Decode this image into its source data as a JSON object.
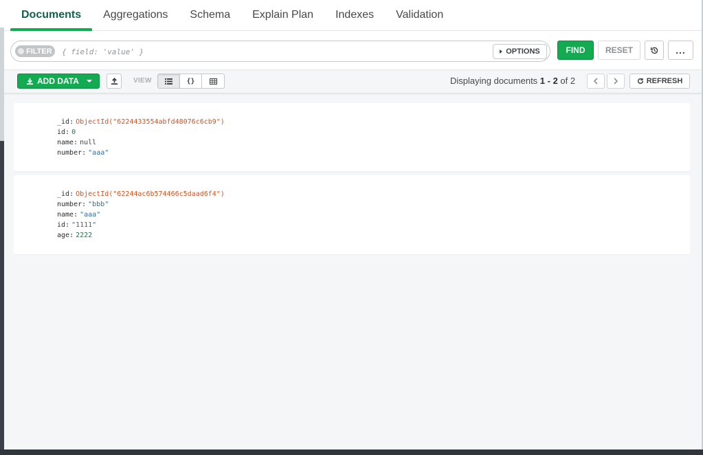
{
  "tabs": [
    {
      "label": "Documents",
      "active": true
    },
    {
      "label": "Aggregations",
      "active": false
    },
    {
      "label": "Schema",
      "active": false
    },
    {
      "label": "Explain Plan",
      "active": false
    },
    {
      "label": "Indexes",
      "active": false
    },
    {
      "label": "Validation",
      "active": false
    }
  ],
  "query": {
    "filter_label": "FILTER",
    "filter_placeholder": "{ field: 'value' }",
    "options_label": "OPTIONS",
    "find_label": "FIND",
    "reset_label": "RESET",
    "history_icon": "history-icon",
    "more_label": "..."
  },
  "toolbar": {
    "add_data_label": "ADD DATA",
    "view_label": "VIEW",
    "view_modes": [
      "list-icon",
      "json-icon",
      "table-icon"
    ],
    "view_json_glyph": "{}",
    "paging_prefix": "Displaying documents ",
    "paging_range": "1 - 2",
    "paging_of": " of ",
    "paging_total": "2",
    "refresh_label": "REFRESH"
  },
  "documents": [
    {
      "fields": [
        {
          "key": "_id",
          "value": "ObjectId(\"6224433554abfd48076c6cb9\")",
          "type": "oid"
        },
        {
          "key": "id",
          "value": "0",
          "type": "num"
        },
        {
          "key": "name",
          "value": "null",
          "type": "null"
        },
        {
          "key": "number",
          "value": "\"aaa\"",
          "type": "str"
        }
      ]
    },
    {
      "fields": [
        {
          "key": "_id",
          "value": "ObjectId(\"62244ac6b574466c5daad6f4\")",
          "type": "oid"
        },
        {
          "key": "number",
          "value": "\"bbb\"",
          "type": "str"
        },
        {
          "key": "name",
          "value": "\"aaa\"",
          "type": "str"
        },
        {
          "key": "id",
          "value": "\"1111\"",
          "type": "str"
        },
        {
          "key": "age",
          "value": "2222",
          "type": "num"
        }
      ]
    }
  ],
  "colors": {
    "accent_green": "#13aa52",
    "objectid": "#d6511c",
    "string": "#2b6ca3"
  }
}
